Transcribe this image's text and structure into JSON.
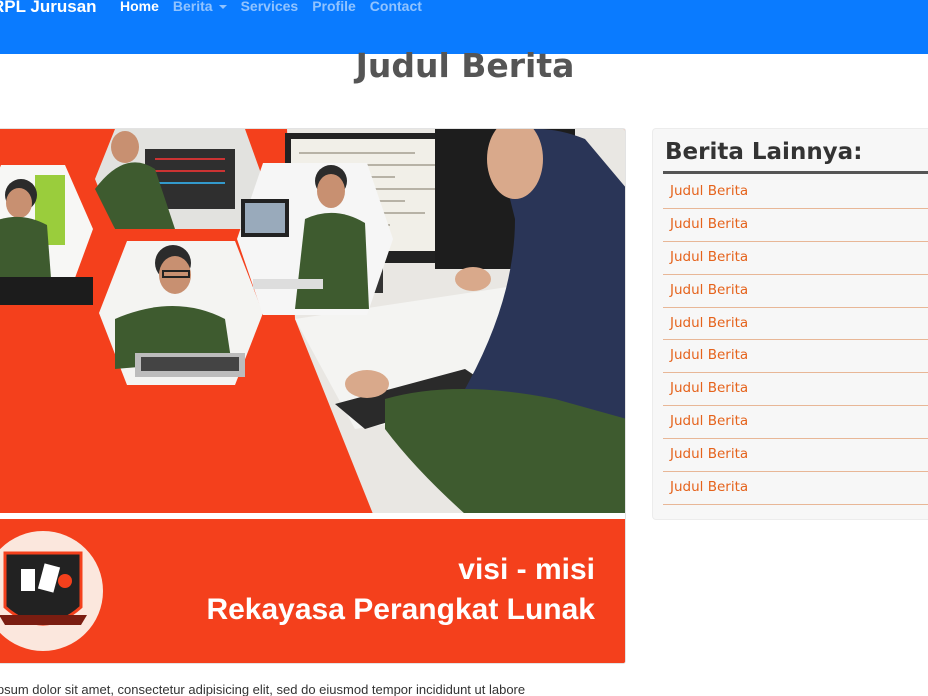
{
  "navbar": {
    "brand": "RPL Jurusan",
    "items": [
      {
        "label": "Home",
        "active": true
      },
      {
        "label": "Berita",
        "dropdown": true
      },
      {
        "label": "Services"
      },
      {
        "label": "Profile"
      },
      {
        "label": "Contact"
      }
    ]
  },
  "article": {
    "title": "Judul Berita",
    "hero": {
      "banner_line1": "visi - misi",
      "banner_line2": "Rekayasa Perangkat Lunak"
    },
    "body_text": "ipsum dolor sit amet, consectetur adipisicing elit, sed do eiusmod tempor incididunt ut labore"
  },
  "sidebar": {
    "title": "Berita Lainnya:",
    "items": [
      "Judul Berita",
      "Judul Berita",
      "Judul Berita",
      "Judul Berita",
      "Judul Berita",
      "Judul Berita",
      "Judul Berita",
      "Judul Berita",
      "Judul Berita",
      "Judul Berita"
    ]
  },
  "colors": {
    "navbar": "#0a7bff",
    "accent_orange": "#f4401c",
    "link": "#e5631c",
    "uniform_green": "#3e5b2f"
  },
  "icons": [
    "school-logo-icon",
    "caret-down-icon"
  ]
}
